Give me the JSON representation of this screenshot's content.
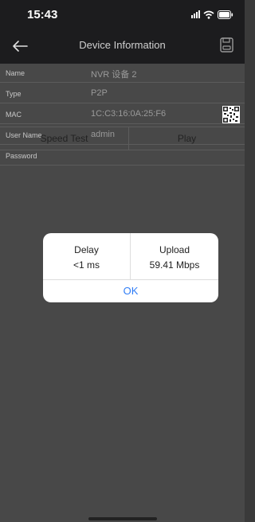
{
  "status_bar": {
    "time": "15:43"
  },
  "nav": {
    "title": "Device Information",
    "back_icon": "back-arrow-icon",
    "save_icon": "save-icon"
  },
  "fields": [
    {
      "label": "Name",
      "value": "NVR 设备 2"
    },
    {
      "label": "Type",
      "value": "P2P"
    },
    {
      "label": "MAC",
      "value": "1C:C3:16:0A:25:F6",
      "icon": "qr-code-icon"
    },
    {
      "label": "User Name",
      "value": "admin"
    },
    {
      "label": "Password",
      "value": ""
    }
  ],
  "buttons": {
    "speed_test": "Speed Test",
    "play": "Play"
  },
  "dialog": {
    "delay_label": "Delay",
    "delay_value": "<1 ms",
    "upload_label": "Upload",
    "upload_value": "59.41 Mbps",
    "ok_label": "OK"
  },
  "colors": {
    "accent": "#2f7df6",
    "nav_bg": "#1c1c1e",
    "page_bg": "#484848"
  }
}
